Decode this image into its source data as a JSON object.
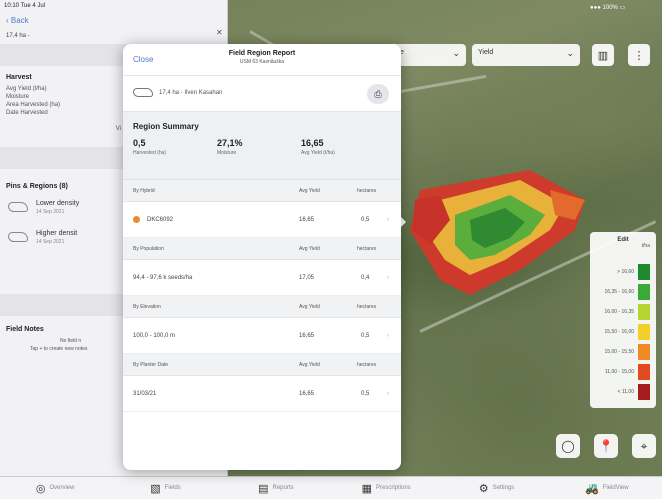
{
  "status_bar": {
    "time": "10:10 Tue 4 Jul",
    "battery": "●●● 100% ▭"
  },
  "sidebar": {
    "back_label": "Back",
    "field_info": "17,4 ha -",
    "harvest": {
      "title": "Harvest",
      "rows": [
        {
          "label": "Avg Yield (t/ha)"
        },
        {
          "label": "Moisture"
        },
        {
          "label": "Area Harvested (ha)"
        },
        {
          "label": "Date Harvested"
        }
      ],
      "view_label": "Vi"
    },
    "pins_regions": {
      "title": "Pins & Regions (8)",
      "items": [
        {
          "title": "Lower density",
          "date": "14 Sep 2021"
        },
        {
          "title": "Higher densit",
          "date": "14 Sep 2021"
        }
      ]
    },
    "field_notes": {
      "title": "Field Notes",
      "line1": "No field n",
      "line2": "Tap + to create new notes"
    }
  },
  "map_controls": {
    "select1": "e",
    "select2": "Yield"
  },
  "legend": {
    "title": "Edit",
    "unit": "t/ha",
    "rows": [
      {
        "label": "> 16,60",
        "color": "#1e8a2e"
      },
      {
        "label": "16,35 - 16,60",
        "color": "#3aa936"
      },
      {
        "label": "16,00 - 16,35",
        "color": "#b8d430"
      },
      {
        "label": "15,50 - 16,00",
        "color": "#f2d02b"
      },
      {
        "label": "15,00 - 15,50",
        "color": "#f08a24"
      },
      {
        "label": "11,00 - 15,00",
        "color": "#e34a1f"
      },
      {
        "label": "< 11,00",
        "color": "#a61d1d"
      }
    ]
  },
  "tabbar": [
    {
      "label": "Overview",
      "icon": "compass-icon"
    },
    {
      "label": "Fields",
      "icon": "map-icon"
    },
    {
      "label": "Reports",
      "icon": "report-icon"
    },
    {
      "label": "Prescriptions",
      "icon": "prescription-icon"
    },
    {
      "label": "Settings",
      "icon": "gear-icon"
    },
    {
      "label": "FieldView",
      "icon": "tractor-icon"
    }
  ],
  "report": {
    "close_label": "Close",
    "title": "Field Region Report",
    "subtitle": "USM 63 Kasnåuška",
    "field_text": "17,4 ha - Ilven Kasahan",
    "summary": {
      "title": "Region Summary",
      "items": [
        {
          "value": "0,5",
          "label": "Harvested (ha)"
        },
        {
          "value": "27,1%",
          "label": "Moisture"
        },
        {
          "value": "16,65",
          "label": "Avg Yield (t/ha)"
        }
      ]
    },
    "sections": [
      {
        "header": "By Hybrid",
        "col1": "Avg Yield",
        "col2": "hectares",
        "row": {
          "name": "DKC6092",
          "yield": "16,65",
          "ha": "0,5",
          "dot": true
        }
      },
      {
        "header": "By Population",
        "col1": "Avg Yield",
        "col2": "hectares",
        "row": {
          "name": "94,4 - 97,6 k seeds/ha",
          "yield": "17,05",
          "ha": "0,4",
          "dot": false
        }
      },
      {
        "header": "By Elevation",
        "col1": "Avg Yield",
        "col2": "hectares",
        "row": {
          "name": "100,0 - 100,0 m",
          "yield": "16,65",
          "ha": "0,5",
          "dot": false
        }
      },
      {
        "header": "By Planter Date",
        "col1": "Avg Yield",
        "col2": "hectares",
        "row": {
          "name": "31/03/21",
          "yield": "16,65",
          "ha": "0,5",
          "dot": false
        }
      }
    ]
  }
}
